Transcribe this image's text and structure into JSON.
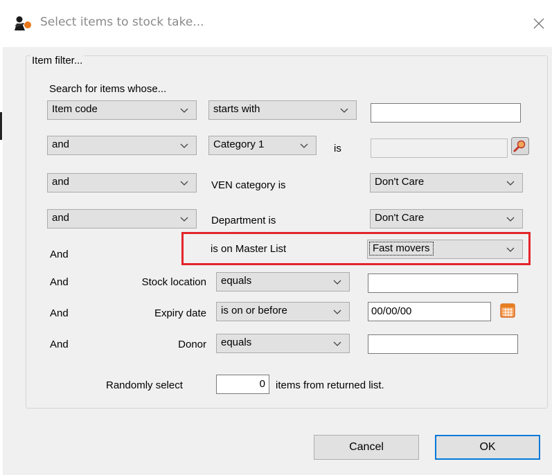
{
  "window": {
    "title": "Select items to stock take...",
    "icon": "app-logo-icon",
    "close_icon": "close-icon"
  },
  "filter": {
    "group_label": "Item filter...",
    "search_heading": "Search for items whose...",
    "rows": {
      "r1": {
        "field": "Item code",
        "operator": "starts with",
        "value": ""
      },
      "r2": {
        "conjunction": "and",
        "field": "Category 1",
        "is_label": "is",
        "value": ""
      },
      "r3": {
        "conjunction": "and",
        "label": "VEN category is",
        "value": "Don't Care"
      },
      "r4": {
        "conjunction": "and",
        "label": "Department is",
        "value": "Don't Care"
      },
      "r5": {
        "conjunction": "And",
        "label": "is on Master List",
        "value": "Fast movers"
      },
      "r6": {
        "conjunction": "And",
        "label": "Stock location",
        "operator": "equals",
        "value": ""
      },
      "r7": {
        "conjunction": "And",
        "label": "Expiry date",
        "operator": "is on or before",
        "value": "00/00/00"
      },
      "r8": {
        "conjunction": "And",
        "label": "Donor",
        "operator": "equals",
        "value": ""
      }
    },
    "random": {
      "prefix": "Randomly select",
      "count": "0",
      "suffix": "items from returned list."
    }
  },
  "buttons": {
    "cancel": "Cancel",
    "ok": "OK"
  },
  "colors": {
    "highlight": "#e3242b",
    "default_button_border": "#0078d7",
    "dialog_background": "#f0f0f0"
  }
}
